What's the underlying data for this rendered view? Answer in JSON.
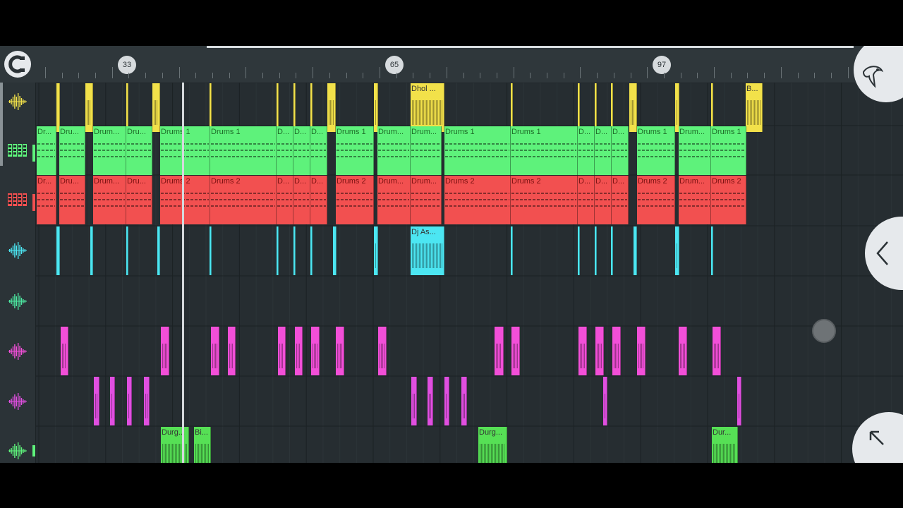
{
  "ruler": {
    "bar_markers": [
      "33",
      "65",
      "97"
    ]
  },
  "sidebar": {
    "tracks": [
      {
        "type": "audio",
        "icon": "waveform-icon",
        "color": "#f2e14a"
      },
      {
        "type": "pattern",
        "icon": "step-sequencer-icon",
        "color": "#5ef27b"
      },
      {
        "type": "pattern",
        "icon": "step-sequencer-icon",
        "color": "#f25050"
      },
      {
        "type": "audio",
        "icon": "waveform-icon",
        "color": "#4ce6f2"
      },
      {
        "type": "audio",
        "icon": "waveform-icon",
        "color": "#4ce6a0"
      },
      {
        "type": "audio",
        "icon": "waveform-icon",
        "color": "#f24fd8"
      },
      {
        "type": "audio",
        "icon": "waveform-icon",
        "color": "#e04fe0"
      },
      {
        "type": "audio",
        "icon": "waveform-icon",
        "color": "#5ef27b"
      }
    ]
  },
  "colors": {
    "yellow": "#f2e14a",
    "green": "#5ef27b",
    "red": "#f25050",
    "cyan": "#4ce6f2",
    "pink": "#f24fd8",
    "magenta": "#e04fe0",
    "lime": "#56e055"
  },
  "clip_labels": {
    "dhol": "Dhol ...",
    "b": "B...",
    "drums1_short": "Dr...",
    "drums1_mid": "Dru...",
    "drums1_long": "Drum...",
    "drums1": "Drums 1",
    "drums1_d": "D...",
    "drums2_short": "Dr...",
    "drums2_mid": "Dru...",
    "drums2_long": "Drum...",
    "drums2": "Drums 2",
    "drums2_d": "D...",
    "dj": "Dj As...",
    "durg": "Durg...",
    "bi": "Bi...",
    "dur": "Dur..."
  },
  "buttons": {
    "fl_menu": "fl-logo-icon",
    "collapse": "chevron-left-icon",
    "expand": "arrow-up-left-icon"
  }
}
